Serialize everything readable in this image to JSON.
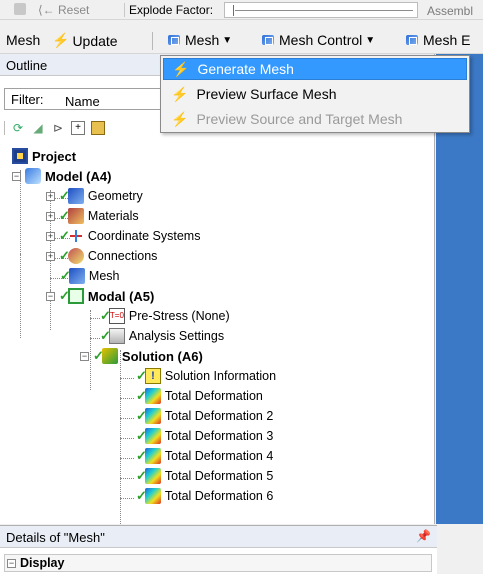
{
  "explode_toolbar": {
    "reset_label": "⟨← Reset",
    "explode_label": "Explode Factor:",
    "explode_value": 0,
    "assembly_label": "Assembl"
  },
  "main_toolbar": {
    "mesh_label": "Mesh",
    "update_label": "Update",
    "mesh_menu_label": "Mesh",
    "mesh_control_label": "Mesh Control",
    "mesh_edit_label": "Mesh E"
  },
  "dropdown": {
    "items": [
      {
        "label": "Generate Mesh",
        "state": "selected"
      },
      {
        "label": "Preview Surface Mesh",
        "state": "normal"
      },
      {
        "label": "Preview Source and Target Mesh",
        "state": "disabled"
      }
    ]
  },
  "outline": {
    "title": "Outline",
    "filter_label": "Filter:",
    "filter_value": "Name",
    "tree": [
      {
        "label": "Project",
        "icon": "project-icon"
      },
      {
        "label": "Model (A4)",
        "icon": "model-icon"
      },
      {
        "label": "Geometry",
        "icon": "geometry-icon"
      },
      {
        "label": "Materials",
        "icon": "materials-icon"
      },
      {
        "label": "Coordinate Systems",
        "icon": "coordinate-systems-icon"
      },
      {
        "label": "Connections",
        "icon": "connections-icon"
      },
      {
        "label": "Mesh",
        "icon": "mesh-icon"
      },
      {
        "label": "Modal (A5)",
        "icon": "modal-icon"
      },
      {
        "label": "Pre-Stress (None)",
        "icon": "prestress-icon"
      },
      {
        "label": "Analysis Settings",
        "icon": "analysis-settings-icon"
      },
      {
        "label": "Solution (A6)",
        "icon": "solution-icon"
      },
      {
        "label": "Solution Information",
        "icon": "solution-info-icon"
      },
      {
        "label": "Total Deformation",
        "icon": "deformation-icon"
      },
      {
        "label": "Total Deformation 2",
        "icon": "deformation-icon"
      },
      {
        "label": "Total Deformation 3",
        "icon": "deformation-icon"
      },
      {
        "label": "Total Deformation 4",
        "icon": "deformation-icon"
      },
      {
        "label": "Total Deformation 5",
        "icon": "deformation-icon"
      },
      {
        "label": "Total Deformation 6",
        "icon": "deformation-icon"
      }
    ]
  },
  "details": {
    "title": "Details of \"Mesh\"",
    "pin_glyph": "📌",
    "section_label": "Display"
  }
}
